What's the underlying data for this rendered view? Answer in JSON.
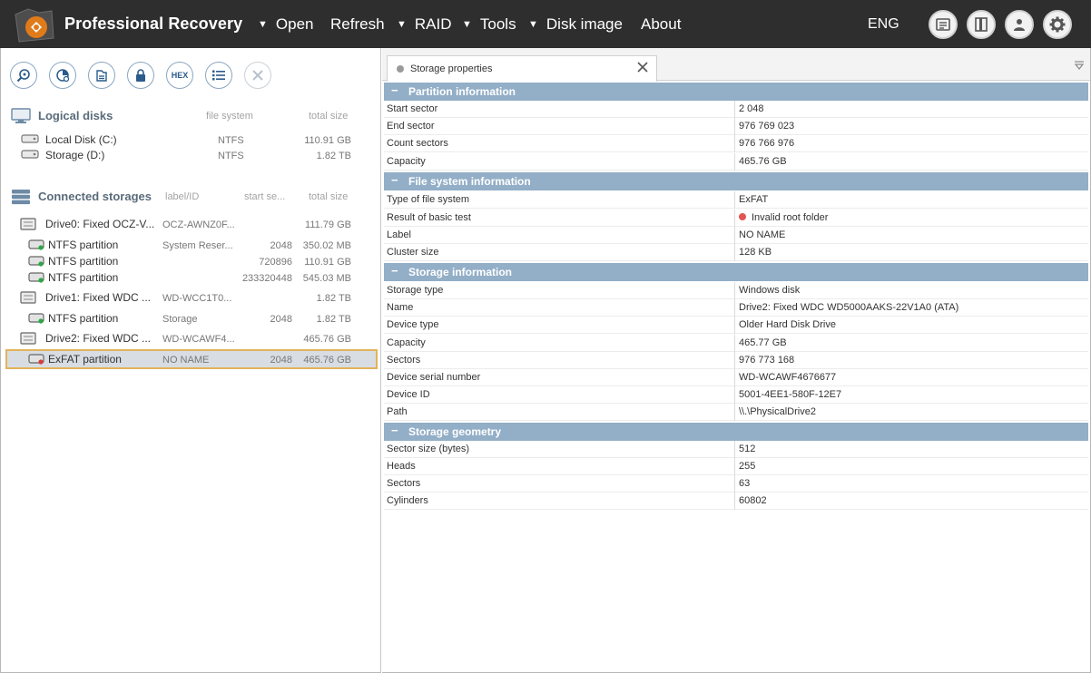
{
  "app": {
    "title": "Professional Recovery",
    "menu": [
      "Open",
      "Refresh",
      "RAID",
      "Tools",
      "Disk image",
      "About"
    ],
    "menu_arrows": [
      "▼",
      "",
      "▼",
      "▼",
      "▼",
      ""
    ],
    "language": "ENG",
    "header_icons": [
      "log-icon",
      "panel-toggle-icon",
      "user-icon",
      "settings-gear-icon"
    ],
    "accent_color": "#e07b1a"
  },
  "toolbar": {
    "icons": [
      "search-icon",
      "scan-pie-icon",
      "file-scan-icon",
      "lock-icon",
      "hex-icon",
      "list-icon",
      "close-icon"
    ],
    "hex_label": "HEX"
  },
  "logical_disks": {
    "title": "Logical disks",
    "columns": [
      "file system",
      "total size"
    ],
    "items": [
      {
        "name": "Local Disk (C:)",
        "fs": "NTFS",
        "size": "110.91 GB"
      },
      {
        "name": "Storage (D:)",
        "fs": "NTFS",
        "size": "1.82 TB"
      }
    ]
  },
  "storages": {
    "title": "Connected storages",
    "columns": [
      "label/ID",
      "start se...",
      "total size"
    ],
    "rows": [
      {
        "name": "Drive0: Fixed OCZ-V...",
        "label": "OCZ-AWNZ0F...",
        "start": "",
        "size": "111.79 GB",
        "kind": "drive"
      },
      {
        "name": "NTFS partition",
        "label": "System Reser...",
        "start": "2048",
        "size": "350.02 MB",
        "kind": "part"
      },
      {
        "name": "NTFS partition",
        "label": "",
        "start": "720896",
        "size": "110.91 GB",
        "kind": "part"
      },
      {
        "name": "NTFS partition",
        "label": "",
        "start": "233320448",
        "size": "545.03 MB",
        "kind": "part"
      },
      {
        "name": "Drive1: Fixed WDC ...",
        "label": "WD-WCC1T0...",
        "start": "",
        "size": "1.82 TB",
        "kind": "drive"
      },
      {
        "name": "NTFS partition",
        "label": "Storage",
        "start": "2048",
        "size": "1.82 TB",
        "kind": "part"
      },
      {
        "name": "Drive2: Fixed WDC ...",
        "label": "WD-WCAWF4...",
        "start": "",
        "size": "465.76 GB",
        "kind": "drive"
      },
      {
        "name": "ExFAT partition",
        "label": "NO NAME",
        "start": "2048",
        "size": "465.76 GB",
        "kind": "part-bad"
      }
    ]
  },
  "properties": {
    "tab_label": "Storage properties",
    "groups": [
      {
        "title": "Partition information",
        "rows": [
          {
            "k": "Start sector",
            "v": "2 048"
          },
          {
            "k": "End sector",
            "v": "976 769 023"
          },
          {
            "k": "Count sectors",
            "v": "976 766 976"
          },
          {
            "k": "Capacity",
            "v": "465.76 GB"
          }
        ]
      },
      {
        "title": "File system information",
        "rows": [
          {
            "k": "Type of file system",
            "v": "ExFAT"
          },
          {
            "k": "Result of basic test",
            "v": "Invalid root folder"
          },
          {
            "k": "Label",
            "v": "NO NAME"
          },
          {
            "k": "Cluster size",
            "v": "128 KB"
          }
        ]
      },
      {
        "title": "Storage information",
        "rows": [
          {
            "k": "Storage type",
            "v": "Windows disk"
          },
          {
            "k": "Name",
            "v": "Drive2: Fixed WDC WD5000AAKS-22V1A0 (ATA)"
          },
          {
            "k": "Device type",
            "v": "Older Hard Disk Drive"
          },
          {
            "k": "Capacity",
            "v": "465.77 GB"
          },
          {
            "k": "Sectors",
            "v": "976 773 168"
          },
          {
            "k": "Device serial number",
            "v": "WD-WCAWF4676677"
          },
          {
            "k": "Device ID",
            "v": "5001-4EE1-580F-12E7"
          },
          {
            "k": "Path",
            "v": "\\\\.\\PhysicalDrive2"
          }
        ]
      },
      {
        "title": "Storage geometry",
        "rows": [
          {
            "k": "Sector size (bytes)",
            "v": "512"
          },
          {
            "k": "Heads",
            "v": "255"
          },
          {
            "k": "Sectors",
            "v": "63"
          },
          {
            "k": "Cylinders",
            "v": "60802"
          }
        ]
      }
    ]
  }
}
